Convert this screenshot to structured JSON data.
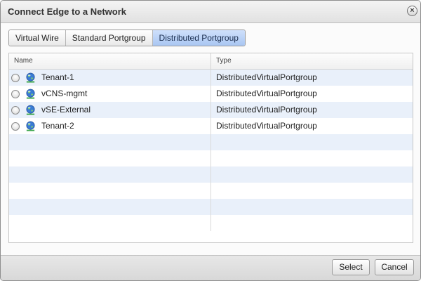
{
  "dialog": {
    "title": "Connect Edge to a Network",
    "close_label": "×"
  },
  "tabs": [
    {
      "label": "Virtual Wire",
      "active": false
    },
    {
      "label": "Standard Portgroup",
      "active": false
    },
    {
      "label": "Distributed Portgroup",
      "active": true
    }
  ],
  "grid": {
    "columns": {
      "name": "Name",
      "type": "Type"
    },
    "rows": [
      {
        "name": "Tenant-1",
        "type": "DistributedVirtualPortgroup",
        "icon": "network-globe-icon",
        "selected": false
      },
      {
        "name": "vCNS-mgmt",
        "type": "DistributedVirtualPortgroup",
        "icon": "network-globe-icon",
        "selected": false
      },
      {
        "name": "vSE-External",
        "type": "DistributedVirtualPortgroup",
        "icon": "network-globe-icon",
        "selected": false
      },
      {
        "name": "Tenant-2",
        "type": "DistributedVirtualPortgroup",
        "icon": "network-globe-icon",
        "selected": false
      }
    ]
  },
  "footer": {
    "select_label": "Select",
    "cancel_label": "Cancel"
  },
  "colors": {
    "active_tab": "#a9c6f2",
    "row_alt": "#e9f0fa",
    "globe": "#3a7bd5"
  }
}
